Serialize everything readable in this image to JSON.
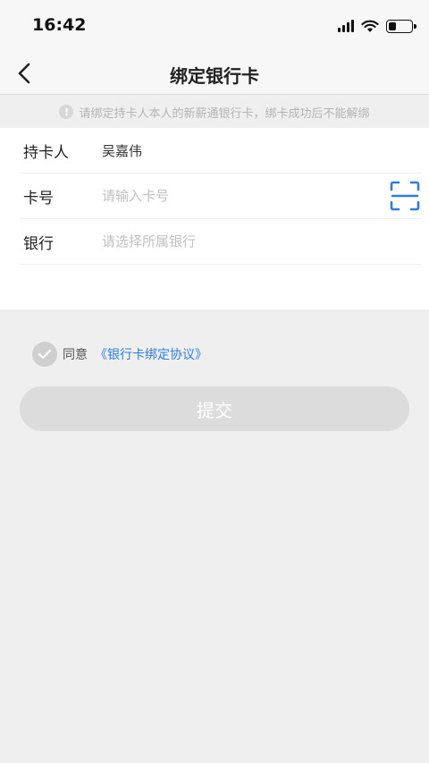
{
  "status_bar": {
    "time": "16:42"
  },
  "nav": {
    "title": "绑定银行卡",
    "back_icon": "chevron-left-icon"
  },
  "notice": {
    "icon": "info-icon",
    "icon_glyph": "!",
    "text": "请绑定持卡人本人的新薪通银行卡，绑卡成功后不能解绑"
  },
  "form": {
    "holder": {
      "label": "持卡人",
      "value": "吴嘉伟"
    },
    "card_number": {
      "label": "卡号",
      "placeholder": "请输入卡号",
      "value": "",
      "scan_icon": "scan-icon"
    },
    "bank": {
      "label": "银行",
      "placeholder": "请选择所属银行",
      "value": ""
    }
  },
  "agreement": {
    "checked": false,
    "prefix": "同意",
    "link_text": "《银行卡绑定协议》"
  },
  "submit": {
    "label": "提交",
    "enabled": false
  },
  "colors": {
    "accent": "#2f7de1",
    "page_bg": "#efefef",
    "button_disabled": "#dcdcdc"
  }
}
